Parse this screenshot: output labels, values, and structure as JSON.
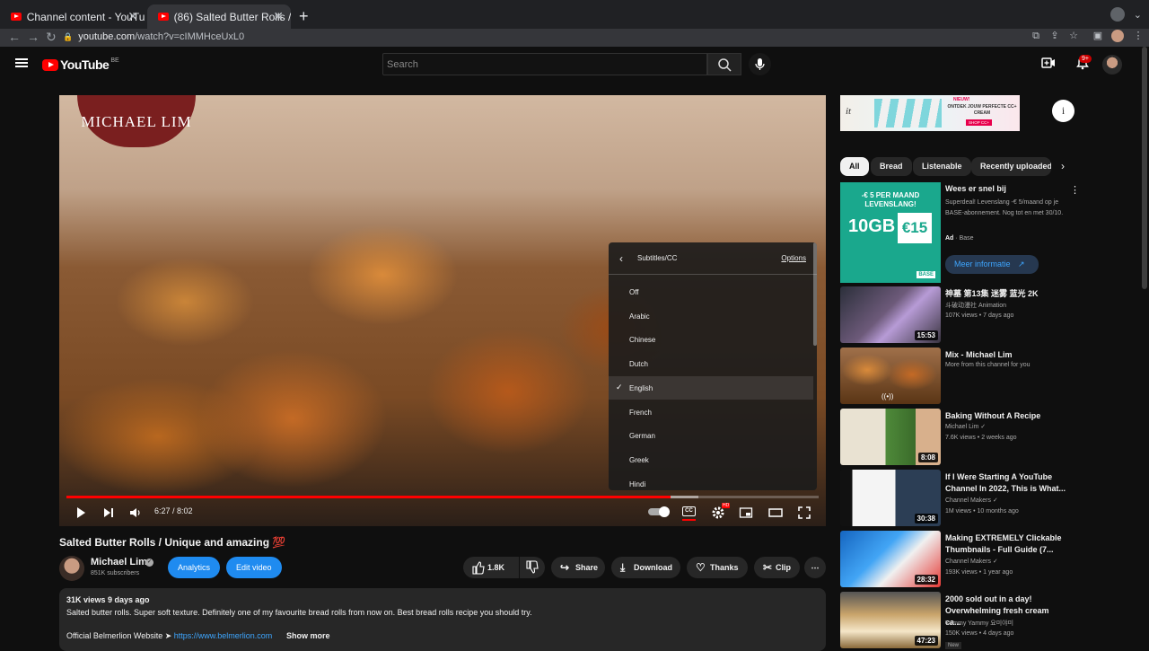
{
  "browser": {
    "tabs": [
      {
        "title": "Channel content - YouTube Stu",
        "active": false
      },
      {
        "title": "(86) Salted Butter Rolls / Uniqu",
        "active": true
      }
    ],
    "url_host": "youtube.com",
    "url_path": "/watch?v=cIMMHceUxL0"
  },
  "header": {
    "logo_text": "YouTube",
    "country_code": "BE",
    "search_placeholder": "Search",
    "notification_count": "9+"
  },
  "player": {
    "overlay_logo": "MICHAEL LIM",
    "time": "6:27 / 8:02",
    "progress": 0.803,
    "buffered": 0.84,
    "cc_label": "CC",
    "hd_label": "HD",
    "subtitles_menu": {
      "title": "Subtitles/CC",
      "options_label": "Options",
      "items": [
        "Off",
        "Arabic",
        "Chinese",
        "Dutch",
        "English",
        "French",
        "German",
        "Greek",
        "Hindi"
      ],
      "selected": "English"
    }
  },
  "video": {
    "title": "Salted Butter Rolls / Unique and amazing 💯",
    "channel": "Michael Lim",
    "subscribers": "851K subscribers",
    "analytics_label": "Analytics",
    "edit_label": "Edit video",
    "likes": "1.8K",
    "share_label": "Share",
    "download_label": "Download",
    "thanks_label": "Thanks",
    "clip_label": "Clip",
    "description": {
      "meta": "31K views  9 days ago",
      "text": "Salted butter rolls. Super soft texture. Definitely one of my favourite bread rolls from now on. Best bread rolls recipe you should try.",
      "website_label": "Official Belmerlion Website ➤ ",
      "website_link": "https://www.belmerlion.com",
      "show_more": "Show more"
    }
  },
  "sidebar": {
    "ad_banner": {
      "brand": "it",
      "new_label": "NIEUW!",
      "headline": "ONTDEK JOUW PERFECTE CC+ CREAM",
      "cta": "SHOP CC+"
    },
    "chips": [
      "All",
      "Bread",
      "Listenable",
      "Recently uploaded"
    ],
    "sponsored": {
      "title": "Wees er snel bij",
      "description": "Superdeal! Levenslang -€ 5/maand op je BASE-abonnement. Nog tot en met 30/10.",
      "ad_label": "Ad",
      "advertiser": "Base",
      "cta": "Meer informatie",
      "thumb_line": "-€ 5 PER MAAND LEVENSLANG!",
      "thumb_gb": "10GB",
      "thumb_price": "€15",
      "thumb_brand": "BASE"
    },
    "recommendations": [
      {
        "title": "神墓 第13集 迷雾 蓝光 2K",
        "channel": "斗破动漫社 Animation",
        "meta": "107K views • 7 days ago",
        "duration": "15:53",
        "verified": false
      },
      {
        "title": "Mix - Michael Lim",
        "channel": "More from this channel for you",
        "meta": "",
        "duration": "",
        "verified": false
      },
      {
        "title": "Baking Without A Recipe",
        "channel": "Michael Lim",
        "meta": "7.6K views • 2 weeks ago",
        "duration": "8:08",
        "verified": true
      },
      {
        "title": "If I Were Starting A YouTube Channel In 2022, This is What...",
        "channel": "Channel Makers",
        "meta": "1M views • 10 months ago",
        "duration": "30:38",
        "verified": true
      },
      {
        "title": "Making EXTREMELY Clickable Thumbnails - Full Guide (7...",
        "channel": "Channel Makers",
        "meta": "193K views • 1 year ago",
        "duration": "28:32",
        "verified": true
      },
      {
        "title": "2000 sold out in a day! Overwhelming fresh cream ca...",
        "channel": "Yummy Yammy 요미야미",
        "meta": "150K views • 4 days ago",
        "duration": "47:23",
        "verified": false,
        "badge": "New"
      }
    ]
  },
  "colors": {
    "brand_red": "#ff0000",
    "accent_blue": "#3ea6ff",
    "background": "#0f0f0f"
  }
}
